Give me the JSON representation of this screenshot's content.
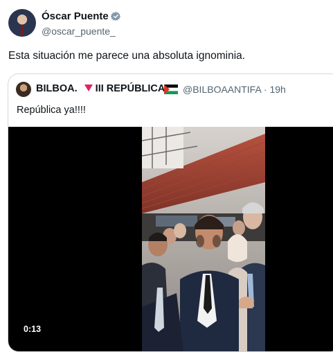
{
  "author": {
    "name": "Óscar Puente",
    "handle": "@oscar_puente_",
    "verified": true,
    "verified_color": "#829aab"
  },
  "tweet": {
    "text": "Esta situación me parece una absoluta ignominia."
  },
  "quoted": {
    "name": "BILBOA.",
    "name_suffix": "III REPÚBLICA",
    "handle": "@BILBOAANTIFA · 19h",
    "text": "República ya!!!!",
    "video": {
      "time": "0:13"
    }
  },
  "colors": {
    "text": "#0f1419",
    "secondary": "#536471",
    "border": "#cfd9de",
    "triangle": "#e0245e"
  },
  "icons": {
    "verified": "verified-badge-icon",
    "triangle": "red-triangle-icon",
    "flag": "palestine-flag-icon"
  }
}
